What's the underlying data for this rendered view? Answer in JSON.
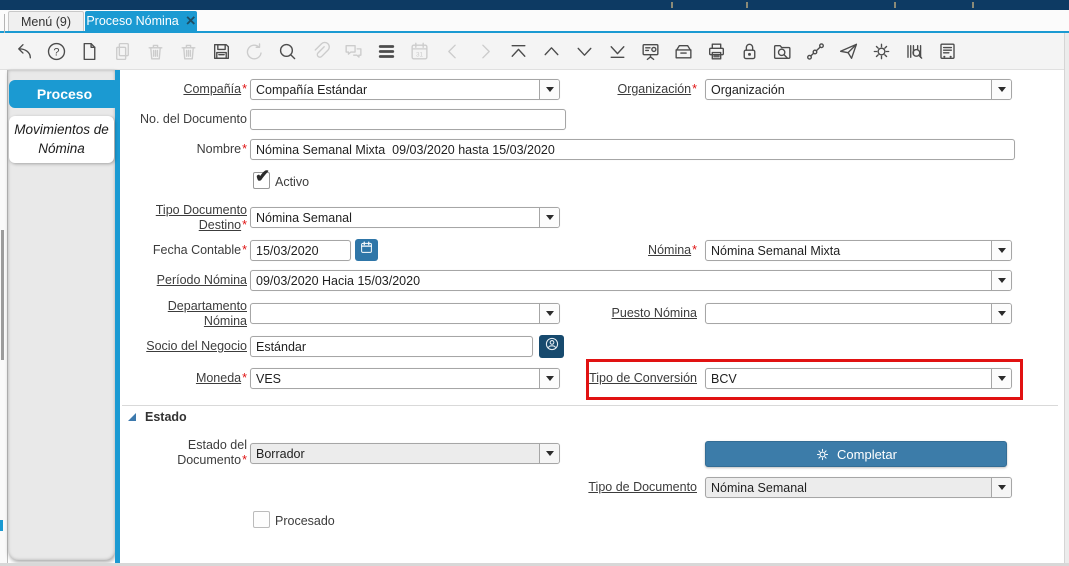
{
  "colors": {
    "accent": "#1b9ad2",
    "navy": "#0d3a63",
    "hl": "#e11212",
    "btnblue": "#3c7ca9",
    "darkbtn": "#174a6e",
    "calbtn": "#2f76a8"
  },
  "titlebar": {
    "tabs": [
      {
        "label": "Menú (9)",
        "active": false
      },
      {
        "label": "Proceso Nómina",
        "active": true,
        "close_icon": "×"
      }
    ]
  },
  "toolbar": {
    "icons": [
      {
        "name": "undo",
        "disabled": false
      },
      {
        "name": "help",
        "disabled": false
      },
      {
        "name": "new-record",
        "disabled": false
      },
      {
        "name": "copy-record",
        "disabled": true
      },
      {
        "name": "delete-record",
        "disabled": true
      },
      {
        "name": "delete-selection",
        "disabled": true
      },
      {
        "name": "save",
        "disabled": false
      },
      {
        "name": "refresh",
        "disabled": true
      },
      {
        "name": "find",
        "disabled": false
      },
      {
        "name": "attachment",
        "disabled": true
      },
      {
        "name": "chat",
        "disabled": true
      },
      {
        "name": "grid-toggle",
        "disabled": false
      },
      {
        "name": "calendar",
        "disabled": true
      },
      {
        "name": "previous-record",
        "disabled": true
      },
      {
        "name": "next-record",
        "disabled": true
      },
      {
        "name": "first-record",
        "disabled": false
      },
      {
        "name": "parent-record",
        "disabled": false
      },
      {
        "name": "detail-record",
        "disabled": false
      },
      {
        "name": "last-record",
        "disabled": false
      },
      {
        "name": "report",
        "disabled": false
      },
      {
        "name": "archive",
        "disabled": false
      },
      {
        "name": "print",
        "disabled": false
      },
      {
        "name": "lock",
        "disabled": false
      },
      {
        "name": "zoom-across",
        "disabled": false
      },
      {
        "name": "workflow",
        "disabled": false
      },
      {
        "name": "send",
        "disabled": false
      },
      {
        "name": "process",
        "disabled": false
      },
      {
        "name": "product-info",
        "disabled": false
      },
      {
        "name": "report-window",
        "disabled": false
      }
    ]
  },
  "sidebar": {
    "items": [
      {
        "label": "Proceso",
        "active": true
      },
      {
        "label": "Movimientos de Nómina",
        "active": false
      }
    ]
  },
  "form": {
    "fields": {
      "compania": {
        "label": "Compañía",
        "required": true,
        "value": "Compañía Estándar"
      },
      "organizacion": {
        "label": "Organización",
        "required": true,
        "value": "Organización"
      },
      "no_documento": {
        "label": "No. del Documento",
        "value": ""
      },
      "nombre": {
        "label": "Nombre",
        "required": true,
        "value": "Nómina Semanal Mixta  09/03/2020 hasta 15/03/2020"
      },
      "activo": {
        "label": "Activo",
        "checked": true
      },
      "tipo_documento_destino": {
        "label_line1": "Tipo Documento",
        "label_line2": "Destino",
        "required": true,
        "value": "Nómina Semanal"
      },
      "fecha_contable": {
        "label": "Fecha Contable",
        "required": true,
        "value": "15/03/2020"
      },
      "nomina": {
        "label": "Nómina",
        "required": true,
        "value": "Nómina Semanal Mixta"
      },
      "periodo_nomina": {
        "label": "Período Nómina",
        "value": "09/03/2020 Hacia 15/03/2020"
      },
      "departamento_nomina": {
        "label_line1": "Departamento",
        "label_line2": "Nómina",
        "value": ""
      },
      "puesto_nomina": {
        "label": "Puesto Nómina",
        "value": ""
      },
      "socio_del_negocio": {
        "label": "Socio del Negocio",
        "value": "Estándar"
      },
      "moneda": {
        "label": "Moneda",
        "required": true,
        "value": "VES"
      },
      "tipo_conversion": {
        "label": "Tipo de Conversión",
        "value": "BCV"
      },
      "estado_documento": {
        "label_line1": "Estado del",
        "label_line2": "Documento",
        "required": true,
        "value": "Borrador"
      },
      "tipo_documento": {
        "label": "Tipo de Documento",
        "value": "Nómina Semanal"
      },
      "procesado": {
        "label": "Procesado",
        "checked": false
      }
    }
  },
  "estado_section": {
    "title": "Estado"
  },
  "buttons": {
    "completar": "Completar"
  }
}
